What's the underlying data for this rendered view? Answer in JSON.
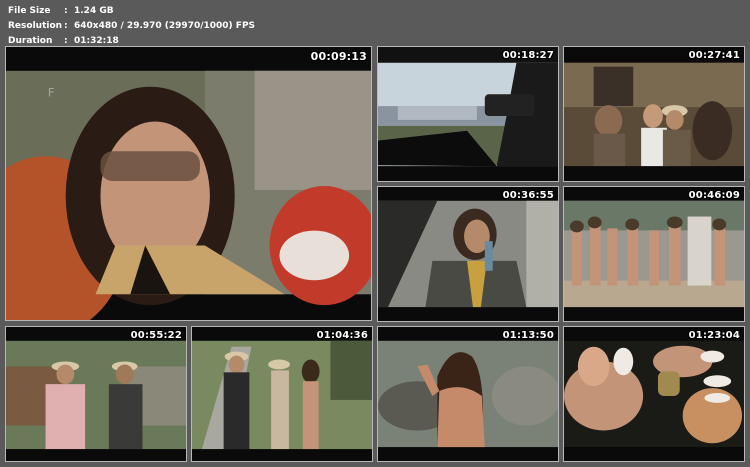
{
  "info": {
    "rows": [
      {
        "key": "File Size",
        "value": "1.24 GB"
      },
      {
        "key": "Resolution",
        "value": "640x480 / 29.970 (29970/1000) FPS"
      },
      {
        "key": "Duration",
        "value": "01:32:18"
      }
    ],
    "separator": ":"
  },
  "thumbnails": [
    {
      "timestamp": "00:09:13"
    },
    {
      "timestamp": "00:18:27"
    },
    {
      "timestamp": "00:27:41"
    },
    {
      "timestamp": "00:36:55"
    },
    {
      "timestamp": "00:46:09"
    },
    {
      "timestamp": "00:55:22"
    },
    {
      "timestamp": "01:04:36"
    },
    {
      "timestamp": "01:13:50"
    },
    {
      "timestamp": "01:23:04"
    }
  ]
}
